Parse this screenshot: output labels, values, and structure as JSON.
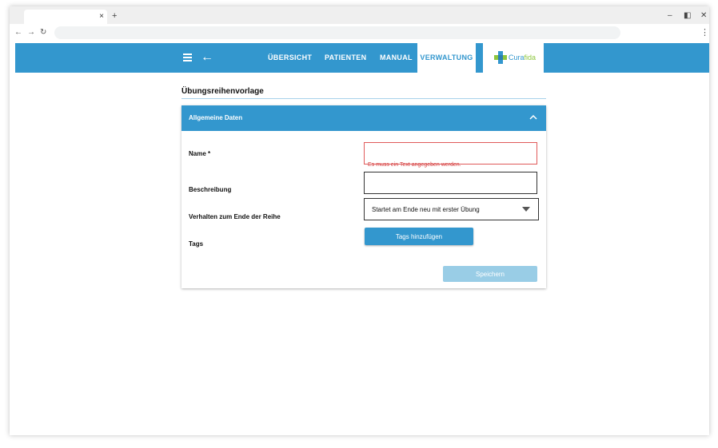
{
  "browser": {
    "tab_close": "×",
    "new_tab": "+",
    "minimize": "–",
    "restore": "◧",
    "close": "✕",
    "back": "←",
    "forward": "→",
    "reload": "↻",
    "menu": "⋮"
  },
  "appbar": {
    "back_arrow": "←",
    "nav": [
      {
        "label": "ÜBERSICHT",
        "active": false
      },
      {
        "label": "PATIENTEN",
        "active": false
      },
      {
        "label": "MANUAL",
        "active": false
      },
      {
        "label": "VERWALTUNG",
        "active": true
      }
    ],
    "logo": {
      "text_a": "Cura",
      "text_b": "fida"
    },
    "colors": {
      "primary": "#3397ce",
      "logo_green": "#8dc63f"
    }
  },
  "page": {
    "title": "Übungsreihenvorlage"
  },
  "card": {
    "title": "Allgemeine Daten",
    "fields": {
      "name_label": "Name *",
      "name_value": "",
      "name_error": "Es muss ein Text angegeben werden.",
      "description_label": "Beschreibung",
      "description_value": "",
      "behavior_label": "Verhalten zum Ende der Reihe",
      "behavior_value": "Startet am Ende neu mit erster Übung",
      "tags_label": "Tags",
      "tags_button": "Tags hinzufügen"
    },
    "save_button": "Speichern"
  }
}
